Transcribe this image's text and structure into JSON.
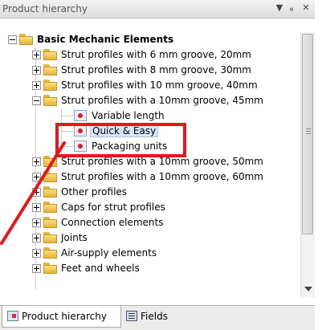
{
  "panel": {
    "title": "Product hierarchy",
    "controls": [
      {
        "name": "dropdown-icon",
        "glyph": "▼"
      },
      {
        "name": "pin-icon",
        "glyph": "ᵩ"
      },
      {
        "name": "close-icon",
        "glyph": "✕"
      }
    ]
  },
  "tree": {
    "root": "Basic Mechanic Elements",
    "items": [
      {
        "label": "Strut profiles with 6 mm groove, 20mm",
        "expanded": false
      },
      {
        "label": "Strut profiles with 8 mm groove, 30mm",
        "expanded": false
      },
      {
        "label": "Strut profiles with 10 mm groove, 40mm",
        "expanded": false
      },
      {
        "label": "Strut profiles with a 10mm groove, 45mm",
        "expanded": true,
        "children": [
          "Variable length",
          "Quick & Easy",
          "Packaging units"
        ]
      },
      {
        "label": "Strut profiles with a 10mm groove, 50mm",
        "expanded": false
      },
      {
        "label": "Strut profiles with a 10mm groove, 60mm",
        "expanded": false
      },
      {
        "label": "Other profiles",
        "expanded": false
      },
      {
        "label": "Caps for strut profiles",
        "expanded": false
      },
      {
        "label": "Connection elements",
        "expanded": false
      },
      {
        "label": "Joints",
        "expanded": false
      },
      {
        "label": "Air-supply elements",
        "expanded": false
      },
      {
        "label": "Feet and wheels",
        "expanded": false
      }
    ],
    "selected_child": "Quick & Easy"
  },
  "tabs": [
    {
      "label": "Product hierarchy",
      "active": true
    },
    {
      "label": "Fields",
      "active": false
    }
  ],
  "colors": {
    "highlight": "#e8151b",
    "selection": "#dbe7f8"
  }
}
